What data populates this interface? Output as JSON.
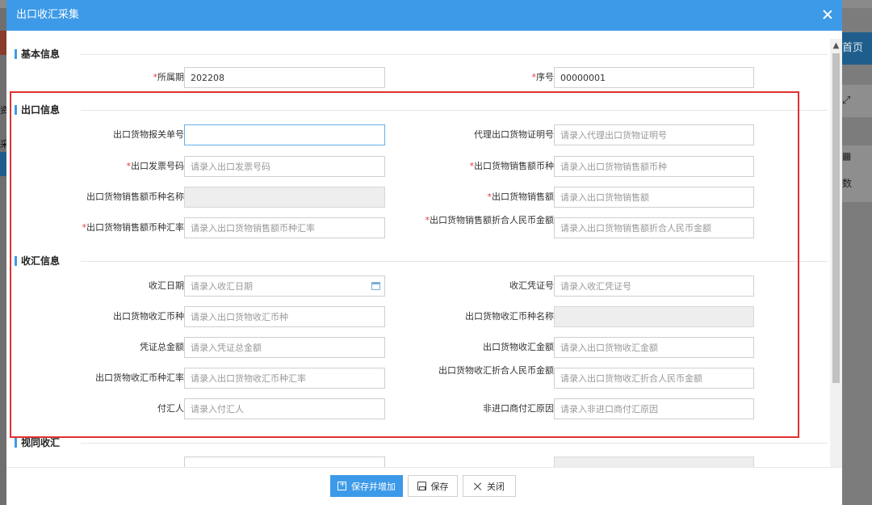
{
  "background": {
    "left_text_1": "资",
    "left_text_2": "采",
    "right_home_label": "首页",
    "right_expand_icon": "expand-icon",
    "right_grid_icon": "grid-icon",
    "right_text": "数"
  },
  "modal": {
    "title": "出口收汇采集",
    "close_icon": "close-icon"
  },
  "sections": {
    "basic": {
      "title": "基本信息",
      "period_label": "所属期",
      "period_value": "202208",
      "seq_label": "序号",
      "seq_value": "00000001"
    },
    "export": {
      "title": "出口信息",
      "customs_no_label": "出口货物报关单号",
      "customs_no_value": "",
      "agent_cert_label": "代理出口货物证明号",
      "agent_cert_placeholder": "请录入代理出口货物证明号",
      "invoice_label": "出口发票号码",
      "invoice_placeholder": "请录入出口发票号码",
      "currency_label": "出口货物销售额币种",
      "currency_placeholder": "请录入出口货物销售额币种",
      "currency_name_label": "出口货物销售额币种名称",
      "sales_label": "出口货物销售额",
      "sales_placeholder": "请录入出口货物销售额",
      "rate_label": "出口货物销售额币种汇率",
      "rate_placeholder": "请录入出口货物销售额币种汇率",
      "rmb_label": "出口货物销售额折合人民币金额",
      "rmb_placeholder": "请录入出口货物销售额折合人民币金额"
    },
    "receipt": {
      "title": "收汇信息",
      "date_label": "收汇日期",
      "date_placeholder": "请录入收汇日期",
      "date_icon": "calendar-icon",
      "voucher_label": "收汇凭证号",
      "voucher_placeholder": "请录入收汇凭证号",
      "currency_label": "出口货物收汇币种",
      "currency_placeholder": "请录入出口货物收汇币种",
      "currency_name_label": "出口货物收汇币种名称",
      "total_label": "凭证总金额",
      "total_placeholder": "请录入凭证总金额",
      "amount_label": "出口货物收汇金额",
      "amount_placeholder": "请录入出口货物收汇金额",
      "rate_label": "出口货物收汇币种汇率",
      "rate_placeholder": "请录入出口货物收汇币种汇率",
      "rmb_label": "出口货物收汇折合人民币金额",
      "rmb_placeholder": "请录入出口货物收汇折合人民币金额",
      "payer_label": "付汇人",
      "payer_placeholder": "请录入付汇人",
      "nonimport_label": "非进口商付汇原因",
      "nonimport_placeholder": "请录入非进口商付汇原因"
    },
    "deemed": {
      "title": "视同收汇"
    }
  },
  "footer": {
    "save_add_label": "保存并增加",
    "save_label": "保存",
    "close_label": "关闭",
    "save_add_icon": "save-add-icon",
    "save_icon": "save-icon",
    "close_icon": "close-icon"
  },
  "colors": {
    "header": "#3c9ae8",
    "required": "#e4393c",
    "highlight": "#e03030"
  }
}
